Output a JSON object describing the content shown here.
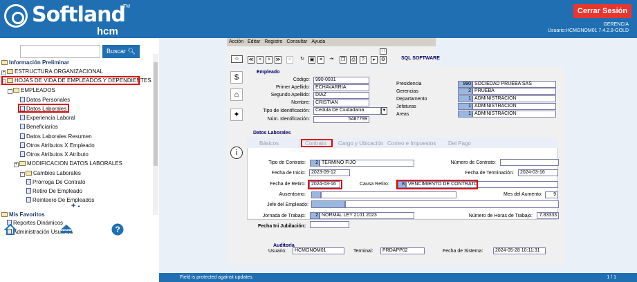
{
  "header": {
    "brand": "Softland",
    "tm": "TM",
    "sub": "hcm",
    "logout": "Cerrar Sesión",
    "company": "GERENCIA",
    "user": "Usuario:HCMGNOM01 7.4.2.8-GOLD"
  },
  "sidebar": {
    "search_button": "Buscar",
    "tree": [
      "Información Preliminar",
      "ESTRUCTURA ORGANIZACIONAL",
      "HOJAS DE VIDA DE EMPLEADOS Y DEPENDIENTES",
      "EMPLEADOS",
      "Datos Personales",
      "Datos Laborales",
      "Experiencia Laboral",
      "Beneficiarios",
      "Datos Laborales Resumen",
      "Otros Atributos X Empleado",
      "Otros Atributos X Atributo",
      "MODIFICACION DATOS LABORALES",
      "Cambios Laborales",
      "Prórroga De Contrato",
      "Retiro De Empleado",
      "Reinteero De Empleados"
    ],
    "pm": "+ -",
    "fav_title": "Mis Favoritos",
    "favs": [
      "Reportes Dinámicos",
      "Administración Usuarios"
    ]
  },
  "menu": [
    "Acción",
    "Editar",
    "Registro",
    "Consultar",
    "Ayuda"
  ],
  "software": "SQL SOFTWARE",
  "employee": {
    "section": "Empleado",
    "labels": [
      "Código:",
      "Primer Apellido:",
      "Segundo Apellido:",
      "Nombre:",
      "Tipo de Identificación:",
      "Núm. Identificación:"
    ],
    "values": [
      "990-0031",
      "ECHAVARRIA",
      "DIAZ",
      "CRISTIAN",
      "Cedula De Ciudadania",
      "5487799"
    ]
  },
  "org": {
    "labels": [
      "Presidencia",
      "Gerencias",
      "Departamento",
      "Jefaturas",
      "Areas"
    ],
    "nums": [
      "990",
      "2",
      "1",
      "1",
      "1"
    ],
    "names": [
      "SOCIEDAD PRUEBA SAS",
      "PRUEBA",
      "ADMINISTRACION",
      "ADMINISTRACION",
      "ADMINISTRACION"
    ]
  },
  "laborales": {
    "section": "Datos Laborales",
    "tabs": [
      "Básicos",
      "Contrato",
      "Cargo y Ubicación",
      "Correo e Impuestos",
      "Del Pago"
    ],
    "tipo_contrato_label": "Tipo de Contrato:",
    "tipo_contrato_num": "2",
    "tipo_contrato": "TERMINO FIJO",
    "num_contrato_label": "Número de Contrato:",
    "fecha_inicio_label": "Fecha de Inicio:",
    "fecha_inicio": "2023-09-12",
    "fecha_term_label": "Fecha de Terminación:",
    "fecha_term": "2024-03-16",
    "fecha_retiro_label": "Fecha de Retiro:",
    "fecha_retiro": "2024-03-16",
    "causa_label": "Causa Retiro:",
    "causa_num": "8",
    "causa": "VENCIMIENTO DE CONTRATO",
    "ausentismo_label": "Ausentismo:",
    "mes_aumento_label": "Mes del Aumento:",
    "mes_aumento": "9",
    "jefe_label": "Jefe del Empleado:",
    "jornada_label": "Jornada de Trabajo:",
    "jornada_num": "2",
    "jornada": "NORMAL LEY 2101 2023",
    "horas_label": "Número de Horas de Trabajo:",
    "horas": "7.83333",
    "jubilacion_label": "Fecha Ini Jubilación:"
  },
  "audit": {
    "title": "Auditoría",
    "usuario_label": "Usuario:",
    "usuario": "HCMGNOM01",
    "terminal_label": "Terminal:",
    "terminal": "PRDAPP02",
    "fecha_label": "Fecha de Sistema:",
    "fecha": "2024-05-28 10:11:31"
  },
  "status": {
    "message": "Field is protected against updates.",
    "pages": "1 / 1"
  }
}
